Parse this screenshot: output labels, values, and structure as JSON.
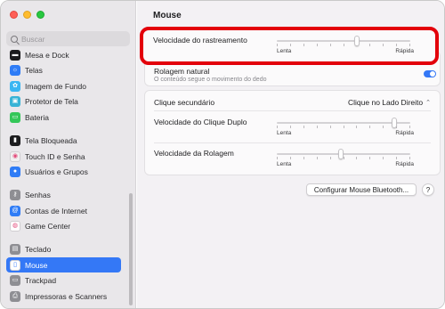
{
  "sidebar": {
    "search": {
      "placeholder": "Buscar"
    },
    "items": [
      {
        "label": "Mesa e Dock",
        "icon": "dock-icon",
        "color": "#1c1c1e",
        "glyph": "▬"
      },
      {
        "label": "Telas",
        "icon": "display-icon",
        "color": "#2f7cf6",
        "glyph": "☼"
      },
      {
        "label": "Imagem de Fundo",
        "icon": "wallpaper-icon",
        "color": "#3ab6f2",
        "glyph": "✿"
      },
      {
        "label": "Protetor de Tela",
        "icon": "screensaver-icon",
        "color": "#38b3d6",
        "glyph": "▣"
      },
      {
        "label": "Bateria",
        "icon": "battery-icon",
        "color": "#34c759",
        "glyph": "▭"
      },
      {
        "label": "Tela Bloqueada",
        "icon": "lock-screen-icon",
        "color": "#1c1c1e",
        "glyph": "▮"
      },
      {
        "label": "Touch ID e Senha",
        "icon": "fingerprint-icon",
        "color": "#f0f0f0",
        "glyph": "◉"
      },
      {
        "label": "Usuários e Grupos",
        "icon": "users-icon",
        "color": "#2f7cf6",
        "glyph": "●"
      },
      {
        "label": "Senhas",
        "icon": "key-icon",
        "color": "#8e8e93",
        "glyph": "⚷"
      },
      {
        "label": "Contas de Internet",
        "icon": "at-icon",
        "color": "#2f7cf6",
        "glyph": "@"
      },
      {
        "label": "Game Center",
        "icon": "game-center-icon",
        "color": "#ffffff",
        "glyph": "◍"
      },
      {
        "label": "Teclado",
        "icon": "keyboard-icon",
        "color": "#8e8e93",
        "glyph": "▤"
      },
      {
        "label": "Mouse",
        "icon": "mouse-icon",
        "color": "#ffffff",
        "glyph": "▯",
        "active": true
      },
      {
        "label": "Trackpad",
        "icon": "trackpad-icon",
        "color": "#8e8e93",
        "glyph": "▭"
      },
      {
        "label": "Impressoras e Scanners",
        "icon": "printer-icon",
        "color": "#8e8e93",
        "glyph": "⎙"
      }
    ]
  },
  "main": {
    "title": "Mouse",
    "tracking_speed": {
      "label": "Velocidade do rastreamento",
      "min_label": "Lenta",
      "max_label": "Rápida",
      "value": 0.6
    },
    "natural_scroll": {
      "label": "Rolagem natural",
      "description": "O conteúdo segue o movimento do dedo",
      "enabled": true
    },
    "secondary_click": {
      "label": "Clique secundário",
      "value": "Clique no Lado Direito"
    },
    "double_click_speed": {
      "label": "Velocidade do Clique Duplo",
      "min_label": "Lenta",
      "max_label": "Rápida",
      "value": 0.88
    },
    "scroll_speed": {
      "label": "Velocidade da Rolagem",
      "min_label": "Lenta",
      "max_label": "Rápida",
      "value": 0.48
    },
    "bluetooth_button": "Configurar Mouse Bluetooth...",
    "help_button": "?"
  },
  "colors": {
    "accent": "#3478f6",
    "highlight": "#e3000b"
  }
}
